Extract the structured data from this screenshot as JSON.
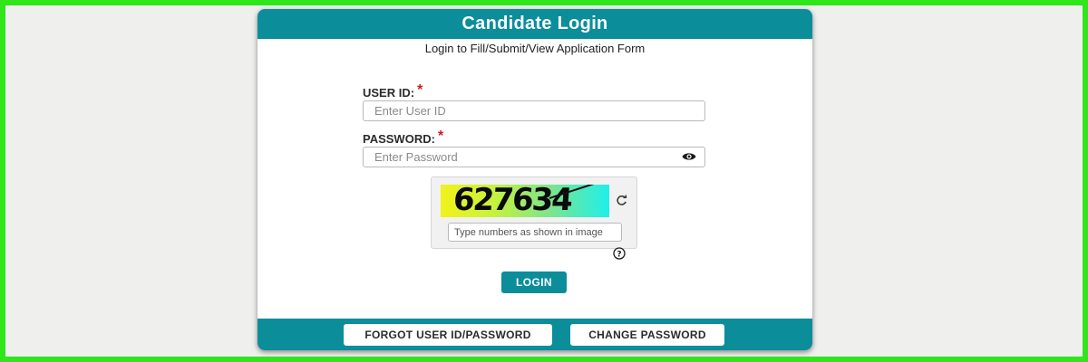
{
  "login_card": {
    "title": "Candidate Login",
    "subtitle": "Login to Fill/Submit/View Application Form"
  },
  "form": {
    "user_id": {
      "label": "USER ID:",
      "required_mark": "*",
      "placeholder": "Enter User ID",
      "value": ""
    },
    "password": {
      "label": "PASSWORD:",
      "required_mark": "*",
      "placeholder": "Enter Password",
      "value": "",
      "toggle_icon": "eye-icon"
    },
    "captcha": {
      "code": "627634",
      "placeholder": "Type numbers as shown in image",
      "value": "",
      "refresh_icon": "refresh-icon",
      "help_icon": "question-circle-icon"
    },
    "login_label": "LOGIN"
  },
  "footer": {
    "forgot_label": "FORGOT USER ID/PASSWORD",
    "change_password_label": "CHANGE PASSWORD"
  },
  "colors": {
    "brand_teal": "#0b8d9a",
    "required_red": "#d11a1a",
    "frame_green": "#2ee61a",
    "page_background": "#efefed"
  }
}
